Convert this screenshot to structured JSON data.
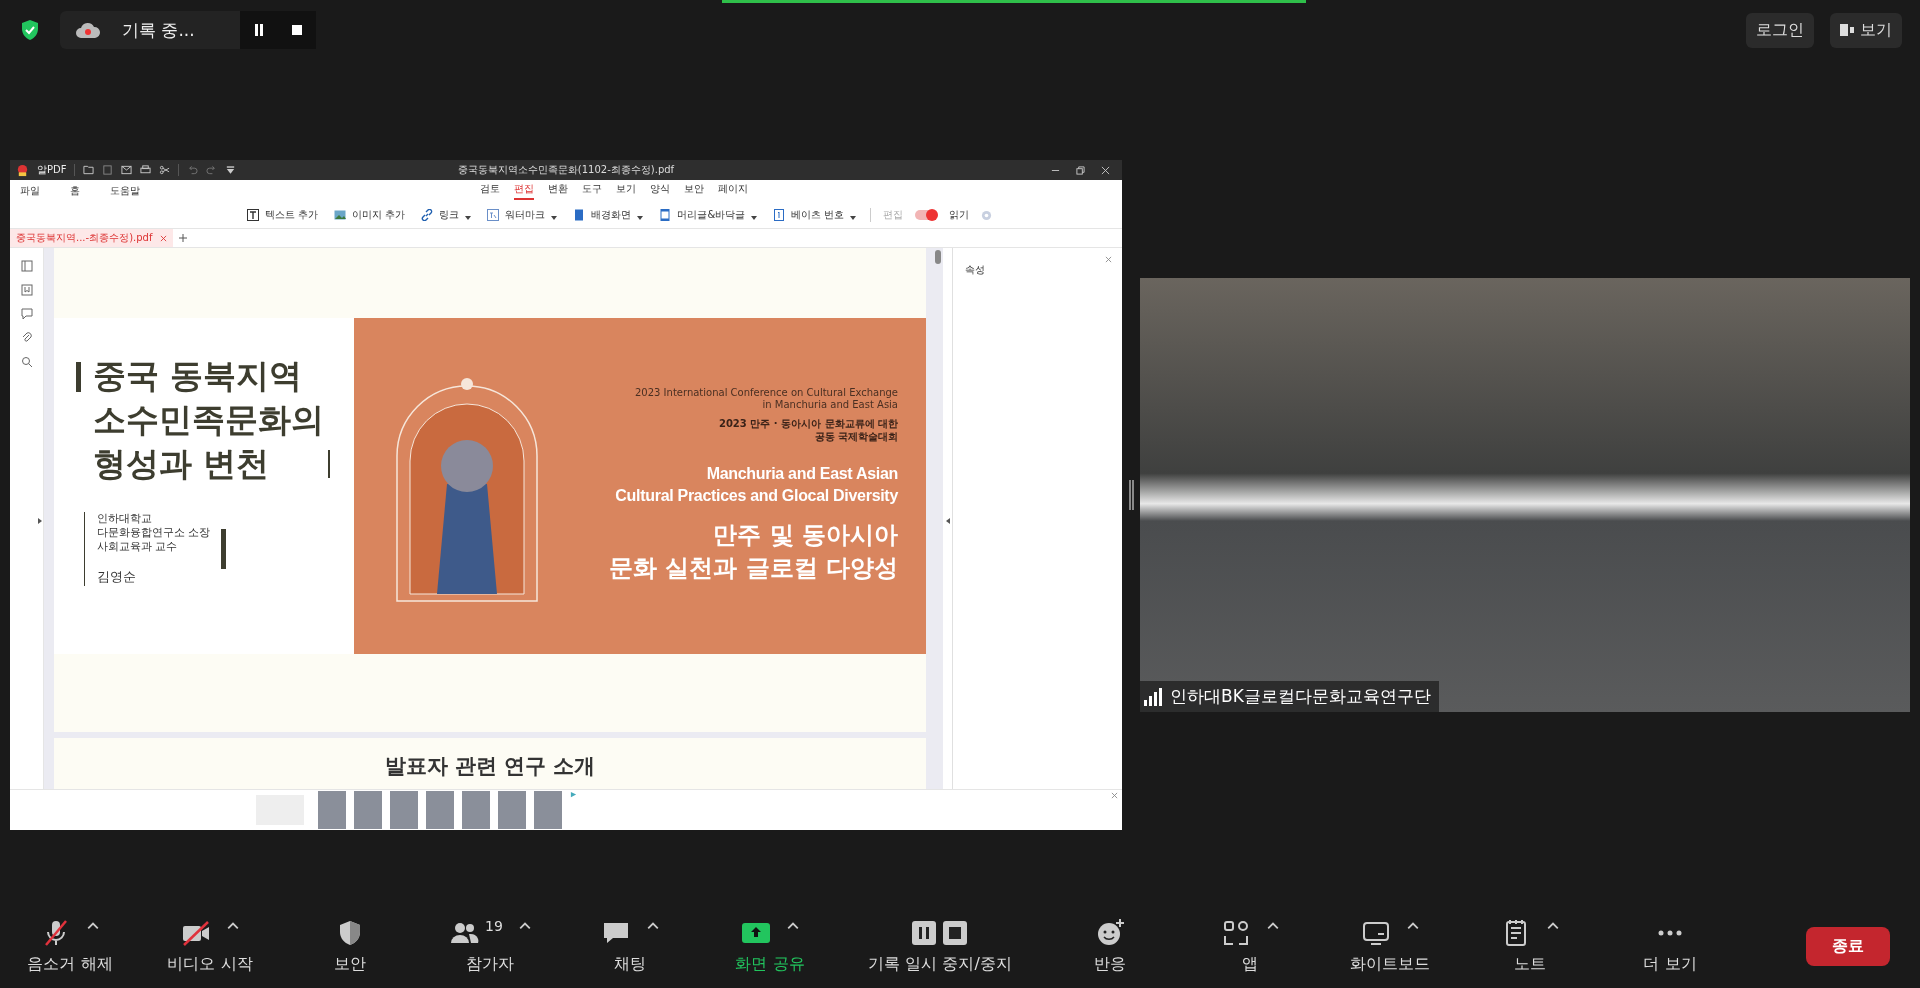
{
  "top_bar": {
    "recording_label": "기록 중...",
    "buttons": [
      {
        "kind": "login",
        "label": "로그인"
      },
      {
        "kind": "view",
        "label": "보기"
      }
    ]
  },
  "pdf_window": {
    "app_name": "알PDF",
    "title": "중국동북지역소수민족문화(1102-최종수정).pdf",
    "menu": [
      "파일",
      "홈",
      "도움말"
    ],
    "ribbon_tabs": [
      {
        "label": "검토",
        "selected": false
      },
      {
        "label": "편집",
        "selected": true
      },
      {
        "label": "변환",
        "selected": false
      },
      {
        "label": "도구",
        "selected": false
      },
      {
        "label": "보기",
        "selected": false
      },
      {
        "label": "양식",
        "selected": false
      },
      {
        "label": "보안",
        "selected": false
      },
      {
        "label": "페이지",
        "selected": false
      }
    ],
    "tools": [
      {
        "kind": "text",
        "label": "텍스트 추가",
        "dropdown": false
      },
      {
        "kind": "image",
        "label": "이미지 추가",
        "dropdown": false
      },
      {
        "kind": "link",
        "label": "링크",
        "dropdown": true
      },
      {
        "kind": "watermark",
        "label": "워터마크",
        "dropdown": true
      },
      {
        "kind": "background",
        "label": "배경화면",
        "dropdown": true
      },
      {
        "kind": "header",
        "label": "머리글&바닥글",
        "dropdown": true
      },
      {
        "kind": "bates",
        "label": "베이츠 번호",
        "dropdown": true
      }
    ],
    "mode_switch": {
      "left_label": "편집",
      "right_label": "읽기",
      "on": true
    },
    "doc_tabs": [
      {
        "label": "중국동북지역...-최종수정).pdf",
        "selected": true
      }
    ],
    "properties_panel": {
      "title": "속성"
    },
    "slide": {
      "title_lines": [
        "중국 동북지역",
        "소수민족문화의",
        "형성과 변천"
      ],
      "affiliation_lines": [
        "인하대학교",
        "다문화융합연구소 소장",
        "사회교육과 교수"
      ],
      "author": "김영순",
      "conference_en_lines": [
        "2023 International Conference on Cultural Exchange",
        "in Manchuria and East Asia"
      ],
      "conference_ko_lines": [
        "2023 만주 · 동아시아 문화교류에 대한",
        "공동 국제학술대회"
      ],
      "theme_en_lines": [
        "Manchuria and East Asian",
        "Cultural Practices and Glocal Diversity"
      ],
      "theme_ko_lines": [
        "만주 및 동아시아",
        "문화 실천과 글로컬 다양성"
      ]
    },
    "next_page_heading": "발표자 관련 연구 소개"
  },
  "video_tile": {
    "name": "인하대BK글로컬다문화교육연구단"
  },
  "meeting_controls": [
    {
      "kind": "mic",
      "label": "음소거 해제",
      "crossed": true,
      "caret": true,
      "active": false
    },
    {
      "kind": "video",
      "label": "비디오 시작",
      "crossed": true,
      "caret": true,
      "active": false
    },
    {
      "kind": "security",
      "label": "보안",
      "crossed": false,
      "caret": false,
      "active": false
    },
    {
      "kind": "participants",
      "label": "참가자",
      "badge": "19",
      "crossed": false,
      "caret": true,
      "active": false
    },
    {
      "kind": "chat",
      "label": "채팅",
      "crossed": false,
      "caret": true,
      "active": false
    },
    {
      "kind": "share",
      "label": "화면 공유",
      "crossed": false,
      "caret": true,
      "active": true
    },
    {
      "kind": "record",
      "label": "기록 일시 중지/중지",
      "crossed": false,
      "caret": false,
      "active": false
    },
    {
      "kind": "reactions",
      "label": "반응",
      "crossed": false,
      "caret": false,
      "active": false
    },
    {
      "kind": "apps",
      "label": "앱",
      "crossed": false,
      "caret": true,
      "active": false
    },
    {
      "kind": "whiteboard",
      "label": "화이트보드",
      "crossed": false,
      "caret": true,
      "active": false
    },
    {
      "kind": "notes",
      "label": "노트",
      "crossed": false,
      "caret": true,
      "active": false
    },
    {
      "kind": "more",
      "label": "더 보기",
      "crossed": false,
      "caret": false,
      "active": false
    }
  ],
  "end_button": {
    "label": "종료"
  }
}
